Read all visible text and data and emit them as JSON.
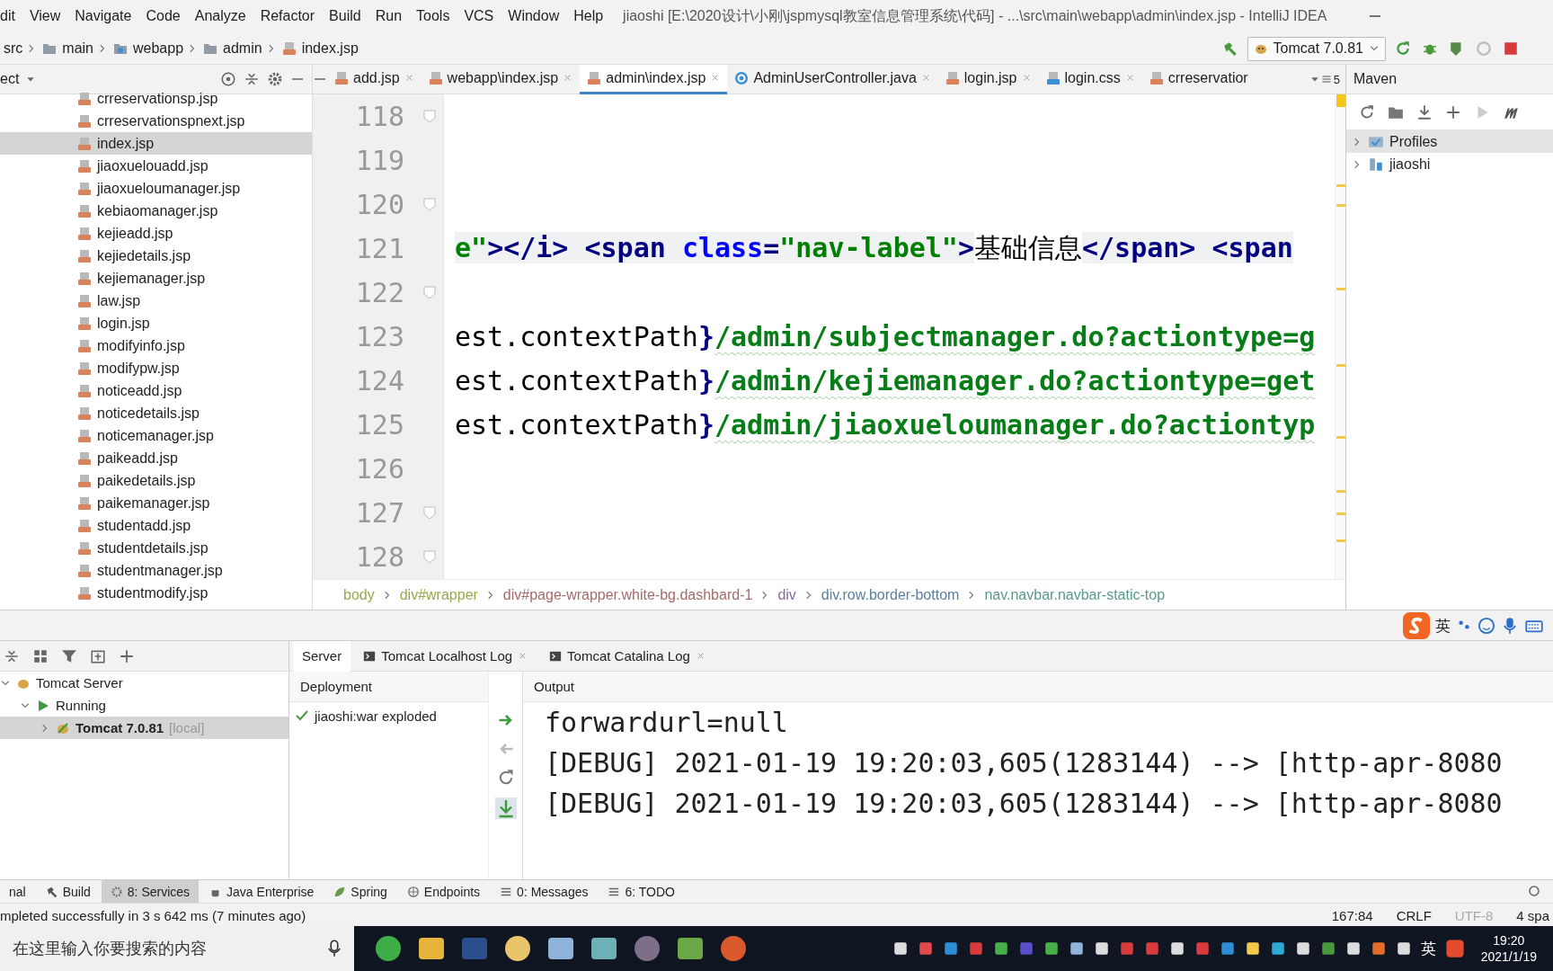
{
  "menu_bar": {
    "items": [
      "dit",
      "View",
      "Navigate",
      "Code",
      "Analyze",
      "Refactor",
      "Build",
      "Run",
      "Tools",
      "VCS",
      "Window",
      "Help"
    ],
    "title": "jiaoshi [E:\\2020设计\\小刚\\jspmysql教室信息管理系统\\代码] - ...\\src\\main\\webapp\\admin\\index.jsp - IntelliJ IDEA"
  },
  "nav_bar": {
    "crumbs": [
      {
        "label": "src",
        "kind": "plain"
      },
      {
        "label": "main",
        "kind": "folder"
      },
      {
        "label": "webapp",
        "kind": "web"
      },
      {
        "label": "admin",
        "kind": "folder"
      },
      {
        "label": "index.jsp",
        "kind": "jsp"
      }
    ],
    "run_config": "Tomcat 7.0.81"
  },
  "project_panel": {
    "title": "ect",
    "files": [
      {
        "name": "crreservationsp.jsp",
        "selected": false
      },
      {
        "name": "crreservationspnext.jsp",
        "selected": false
      },
      {
        "name": "index.jsp",
        "selected": true
      },
      {
        "name": "jiaoxuelouadd.jsp",
        "selected": false
      },
      {
        "name": "jiaoxueloumanager.jsp",
        "selected": false
      },
      {
        "name": "kebiaomanager.jsp",
        "selected": false
      },
      {
        "name": "kejieadd.jsp",
        "selected": false
      },
      {
        "name": "kejiedetails.jsp",
        "selected": false
      },
      {
        "name": "kejiemanager.jsp",
        "selected": false
      },
      {
        "name": "law.jsp",
        "selected": false
      },
      {
        "name": "login.jsp",
        "selected": false
      },
      {
        "name": "modifyinfo.jsp",
        "selected": false
      },
      {
        "name": "modifypw.jsp",
        "selected": false
      },
      {
        "name": "noticeadd.jsp",
        "selected": false
      },
      {
        "name": "noticedetails.jsp",
        "selected": false
      },
      {
        "name": "noticemanager.jsp",
        "selected": false
      },
      {
        "name": "paikeadd.jsp",
        "selected": false
      },
      {
        "name": "paikedetails.jsp",
        "selected": false
      },
      {
        "name": "paikemanager.jsp",
        "selected": false
      },
      {
        "name": "studentadd.jsp",
        "selected": false
      },
      {
        "name": "studentdetails.jsp",
        "selected": false
      },
      {
        "name": "studentmanager.jsp",
        "selected": false
      },
      {
        "name": "studentmodify.jsp",
        "selected": false
      }
    ]
  },
  "editor": {
    "tabs": [
      {
        "label": "add.jsp",
        "kind": "jsp",
        "selected": false
      },
      {
        "label": "webapp\\index.jsp",
        "kind": "jsp",
        "selected": false
      },
      {
        "label": "admin\\index.jsp",
        "kind": "jsp",
        "selected": true
      },
      {
        "label": "AdminUserController.java",
        "kind": "class",
        "selected": false
      },
      {
        "label": "login.jsp",
        "kind": "jsp",
        "selected": false
      },
      {
        "label": "login.css",
        "kind": "css",
        "selected": false
      },
      {
        "label": "crreservatior",
        "kind": "jsp",
        "selected": false
      }
    ],
    "tab_overflow": "5",
    "lines": [
      {
        "number": "118",
        "fold": true
      },
      {
        "number": "119",
        "fold": false
      },
      {
        "number": "120",
        "fold": true
      },
      {
        "number": "121",
        "fold": false,
        "segments": [
          {
            "text": "e\"",
            "kind": "string"
          },
          {
            "text": "></i> ",
            "kind": "tag"
          },
          {
            "text": "<span ",
            "kind": "tag"
          },
          {
            "text": "class",
            "kind": "attr"
          },
          {
            "text": "=",
            "kind": "tag"
          },
          {
            "text": "\"nav-label\"",
            "kind": "string"
          },
          {
            "text": ">",
            "kind": "tag"
          },
          {
            "text": "基础信息",
            "kind": "plain"
          },
          {
            "text": "</span> ",
            "kind": "tag"
          },
          {
            "text": "<span",
            "kind": "tag"
          }
        ]
      },
      {
        "number": "122",
        "fold": true
      },
      {
        "number": "123",
        "fold": false,
        "segments": [
          {
            "text": "est.contextPath",
            "kind": "plain"
          },
          {
            "text": "}",
            "kind": "brace"
          },
          {
            "text": "/admin/subjectmanager.do?actiontype=g",
            "kind": "path"
          }
        ]
      },
      {
        "number": "124",
        "fold": false,
        "segments": [
          {
            "text": "est.contextPath",
            "kind": "plain"
          },
          {
            "text": "}",
            "kind": "brace"
          },
          {
            "text": "/admin/kejiemanager.do?actiontype=get",
            "kind": "path"
          }
        ]
      },
      {
        "number": "125",
        "fold": false,
        "segments": [
          {
            "text": "est.contextPath",
            "kind": "plain"
          },
          {
            "text": "}",
            "kind": "brace"
          },
          {
            "text": "/admin/jiaoxueloumanager.do?actiontyp",
            "kind": "path"
          }
        ]
      },
      {
        "number": "126",
        "fold": false
      },
      {
        "number": "127",
        "fold": true
      },
      {
        "number": "128",
        "fold": true
      }
    ],
    "breadcrumbs": [
      "body",
      "div#wrapper",
      "div#page-wrapper.white-bg.dashbard-1",
      "div",
      "div.row.border-bottom",
      "nav.navbar.navbar-static-top"
    ]
  },
  "maven": {
    "title": "Maven",
    "items": [
      {
        "label": "Profiles",
        "kind": "profiles",
        "selected": true
      },
      {
        "label": "jiaoshi",
        "kind": "module",
        "selected": false
      }
    ]
  },
  "input_method": {
    "mode": "英"
  },
  "services": {
    "tree": [
      {
        "label": "Tomcat Server",
        "expanded": true,
        "selected": false,
        "children": [
          {
            "label": "Running",
            "expanded": true,
            "selected": false,
            "children": [
              {
                "label": "Tomcat 7.0.81",
                "note": "[local]",
                "expanded": false,
                "selected": true
              }
            ]
          }
        ]
      }
    ],
    "tabs": [
      {
        "label": "Server",
        "selected": true
      },
      {
        "label": "Tomcat Localhost Log",
        "selected": false
      },
      {
        "label": "Tomcat Catalina Log",
        "selected": false
      }
    ],
    "deployment_header": "Deployment",
    "deployments": [
      "jiaoshi:war exploded"
    ],
    "output_header": "Output",
    "output_lines": [
      "forwardurl=null",
      "[DEBUG] 2021-01-19 19:20:03,605(1283144) --> [http-apr-8080",
      "[DEBUG] 2021-01-19 19:20:03,605(1283144) --> [http-apr-8080"
    ]
  },
  "tool_strip": [
    {
      "label": "nal",
      "selected": false
    },
    {
      "label": "Build",
      "selected": false
    },
    {
      "label": "8: Services",
      "selected": true
    },
    {
      "label": "Java Enterprise",
      "selected": false
    },
    {
      "label": "Spring",
      "selected": false
    },
    {
      "label": "Endpoints",
      "selected": false
    },
    {
      "label": "0: Messages",
      "selected": false
    },
    {
      "label": "6: TODO",
      "selected": false
    }
  ],
  "status_bar": {
    "message": "mpleted successfully in 3 s 642 ms (7 minutes ago)",
    "position": "167:84",
    "line_separator": "CRLF",
    "encoding": "UTF-8",
    "indent": "4 spa"
  },
  "taskbar": {
    "search_placeholder": "在这里输入你要搜索的内容",
    "ime": "英",
    "time": "19:20",
    "date": "2021/1/19"
  }
}
